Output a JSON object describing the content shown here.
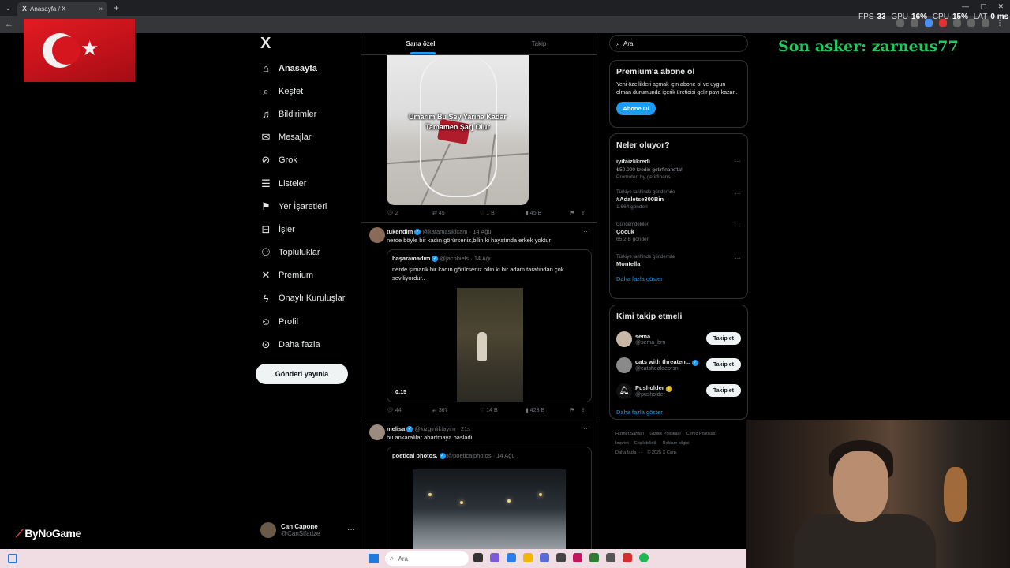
{
  "browser": {
    "tab_title": "Anasayfa / X",
    "tab_logo": "X",
    "new_tab": "+",
    "close_tab": "×"
  },
  "perf": {
    "fps_label": "FPS",
    "fps_value": "33",
    "gpu_label": "GPU",
    "gpu_value": "16%",
    "cpu_label": "CPU",
    "cpu_value": "15%",
    "lat_label": "LAT",
    "lat_value": "0 ms"
  },
  "overlay": {
    "son_asker": "Son asker: zarneus77",
    "bynogame": "ByNoGame"
  },
  "nav": {
    "logo": "X",
    "items": [
      {
        "label": "Anasayfa",
        "icon": "home-icon",
        "glyph": "⌂"
      },
      {
        "label": "Keşfet",
        "icon": "search-icon",
        "glyph": "⌕"
      },
      {
        "label": "Bildirimler",
        "icon": "bell-icon",
        "glyph": "♫"
      },
      {
        "label": "Mesajlar",
        "icon": "envelope-icon",
        "glyph": "✉"
      },
      {
        "label": "Grok",
        "icon": "grok-icon",
        "glyph": "⊘"
      },
      {
        "label": "Listeler",
        "icon": "list-icon",
        "glyph": "☰"
      },
      {
        "label": "Yer İşaretleri",
        "icon": "bookmark-icon",
        "glyph": "⚑"
      },
      {
        "label": "İşler",
        "icon": "briefcase-icon",
        "glyph": "⊟"
      },
      {
        "label": "Topluluklar",
        "icon": "people-icon",
        "glyph": "⚇"
      },
      {
        "label": "Premium",
        "icon": "x-premium-icon",
        "glyph": "✕"
      },
      {
        "label": "Onaylı Kuruluşlar",
        "icon": "lightning-icon",
        "glyph": "ϟ"
      },
      {
        "label": "Profil",
        "icon": "person-icon",
        "glyph": "☺"
      },
      {
        "label": "Daha fazla",
        "icon": "more-circle-icon",
        "glyph": "⊙"
      }
    ],
    "post_button": "Gönderi yayınla"
  },
  "account": {
    "name": "Can Capone",
    "handle": "@CanSifadze",
    "more": "···"
  },
  "timeline": {
    "tabs": [
      "Sana özel",
      "Takip"
    ],
    "post1": {
      "caption": "Umarım Bu Şey Yarına Kadar Tamamen Şarj Olur",
      "replies": "2",
      "reposts": "45",
      "likes": "1 B",
      "views": "45 B"
    },
    "post2": {
      "user": "tükendim",
      "handle": "@kafamasikicam",
      "date": "· 14 Ağu",
      "text": "nerde böyle bir kadın görürseniz,bilin ki hayatında erkek yoktur",
      "quote_user": "başaramadım",
      "quote_handle": "@jacobiels",
      "quote_date": "· 14 Ağu",
      "quote_text": "nerde şımarık bir kadın görürseniz bilin ki bir adam tarafından çok seviliyordur..",
      "video_time": "0:15",
      "replies": "44",
      "reposts": "367",
      "likes": "14 B",
      "views": "423 B"
    },
    "post3": {
      "user": "melisa",
      "handle": "@kizginliktayim",
      "date": "· 21s",
      "text": "bu ankaralilar abartmaya basladi",
      "quote_user": "poetical photos.",
      "quote_handle": "@poeticalphotos",
      "quote_date": "· 14 Ağu"
    },
    "more": "···"
  },
  "right": {
    "search_placeholder": "Ara",
    "premium": {
      "title": "Premium'a abone ol",
      "desc": "Yeni özellikleri açmak için abone ol ve uygun olman durumunda içerik üreticisi gelir payı kazan.",
      "button": "Abone Ol"
    },
    "trends": {
      "title": "Neler oluyor?",
      "items": [
        {
          "cat": "",
          "name": "iyifaizlikredi",
          "sub": "₺50.000 kredin getirfinans'ta!",
          "promo": "Promoted by getirfinans"
        },
        {
          "cat": "Türkiye tarihinde gündemde",
          "name": "#Adaletse300Bin",
          "sub": "1.664 gönderi",
          "promo": ""
        },
        {
          "cat": "Gündemdekiler",
          "name": "Çocuk",
          "sub": "65,2 B gönderi",
          "promo": ""
        },
        {
          "cat": "Türkiye tarihinde gündemde",
          "name": "Montella",
          "sub": "",
          "promo": ""
        }
      ],
      "show_more": "Daha fazla göster"
    },
    "who_to_follow": {
      "title": "Kimi takip etmeli",
      "items": [
        {
          "name": "sema",
          "handle": "@sema_brn",
          "button": "Takip et",
          "verified": false
        },
        {
          "name": "cats with threaten...",
          "handle": "@catshealdeprsn",
          "button": "Takip et",
          "verified": true
        },
        {
          "name": "Pusholder",
          "handle": "@pusholder",
          "button": "Takip et",
          "verified": true
        }
      ],
      "show_more": "Daha fazla göster"
    },
    "footer": [
      "Hizmet Şartları",
      "Gizlilik Politikası",
      "Çerez Politikası",
      "Imprint",
      "Erişilebilirlik",
      "Reklam bilgisi",
      "Daha fazla ···",
      "© 2025 X Corp."
    ]
  },
  "taskbar": {
    "search_placeholder": "Ara"
  },
  "colors": {
    "accent": "#1d9bf0",
    "background": "#000000",
    "border": "#2f3336",
    "muted": "#71767b",
    "overlay_green": "#22c55e"
  }
}
